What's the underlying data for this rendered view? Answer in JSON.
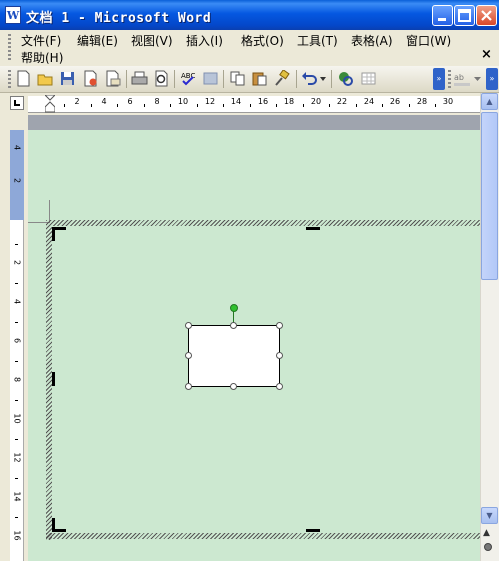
{
  "window": {
    "title": "文档 1 - Microsoft Word",
    "app_icon": "W",
    "controls": [
      "minimize-icon",
      "maximize-icon",
      "close-icon"
    ]
  },
  "menubar": {
    "items": [
      {
        "label": "文件(F)"
      },
      {
        "label": "编辑(E)"
      },
      {
        "label": "视图(V)"
      },
      {
        "label": "插入(I)"
      },
      {
        "label": "格式(O)"
      },
      {
        "label": "工具(T)"
      },
      {
        "label": "表格(A)"
      },
      {
        "label": "窗口(W)"
      },
      {
        "label": "帮助(H)"
      }
    ],
    "doc_close": "×"
  },
  "toolbar": {
    "icons": [
      "new-document-icon",
      "open-icon",
      "save-icon",
      "permission-icon",
      "email-icon",
      "print-icon",
      "print-preview-icon",
      "spelling-icon",
      "research-icon",
      "copy-icon",
      "paste-icon",
      "format-painter-icon",
      "undo-icon",
      "hyperlink-icon",
      "table-icon",
      "highlight-icon"
    ]
  },
  "ruler": {
    "horizontal_labels": [
      "2",
      "4",
      "6",
      "8",
      "10",
      "12",
      "14",
      "16",
      "18",
      "20",
      "22",
      "24",
      "26",
      "28",
      "30"
    ],
    "vertical_labels_top": [
      "4",
      "2"
    ],
    "vertical_labels": [
      "2",
      "4",
      "6",
      "8",
      "10",
      "12",
      "14",
      "16"
    ]
  },
  "colors": {
    "titlebar": "#0558e1",
    "document_background": "#cce8d0",
    "rotate_handle": "#2fc02f"
  }
}
